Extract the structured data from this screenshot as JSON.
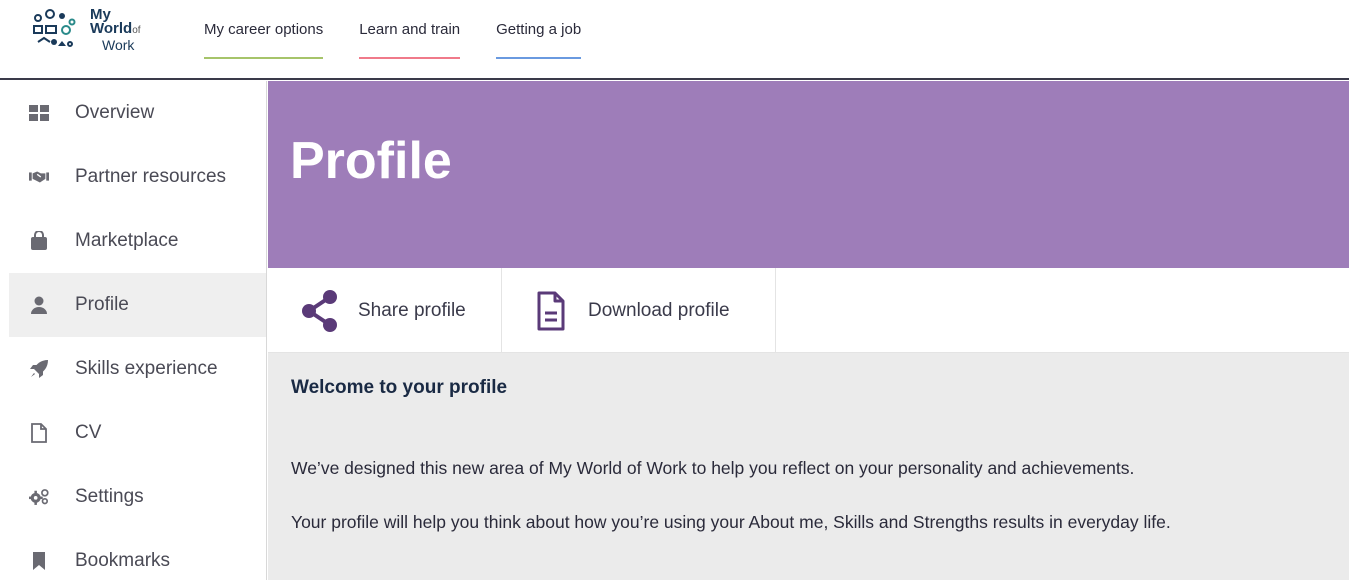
{
  "header": {
    "logo": {
      "line1": "My",
      "line2": "World",
      "line2_small": "of",
      "line3": "Work"
    },
    "nav": [
      {
        "label": "My career options",
        "underline_color": "#a6c46a"
      },
      {
        "label": "Learn and train",
        "underline_color": "#f07a8a"
      },
      {
        "label": "Getting a job",
        "underline_color": "#6a9ae0"
      }
    ]
  },
  "sidebar": {
    "items": [
      {
        "label": "Overview",
        "icon": "grid-icon"
      },
      {
        "label": "Partner resources",
        "icon": "handshake-icon"
      },
      {
        "label": "Marketplace",
        "icon": "bag-icon"
      },
      {
        "label": "Profile",
        "icon": "user-icon",
        "active": true
      },
      {
        "label": "Skills experience",
        "icon": "rocket-icon"
      },
      {
        "label": "CV",
        "icon": "document-icon"
      },
      {
        "label": "Settings",
        "icon": "gears-icon"
      },
      {
        "label": "Bookmarks",
        "icon": "bookmark-icon"
      }
    ]
  },
  "banner": {
    "title": "Profile",
    "color": "#9e7db9"
  },
  "actions": {
    "share_label": "Share profile",
    "download_label": "Download profile",
    "icon_color": "#5a3a78"
  },
  "content": {
    "heading": "Welcome to your profile",
    "para1": "We’ve designed this new area of My World of Work to help you reflect on your personality and achievements.",
    "para2": "Your profile will help you think about how you’re using your About me, Skills and Strengths results in everyday life."
  }
}
